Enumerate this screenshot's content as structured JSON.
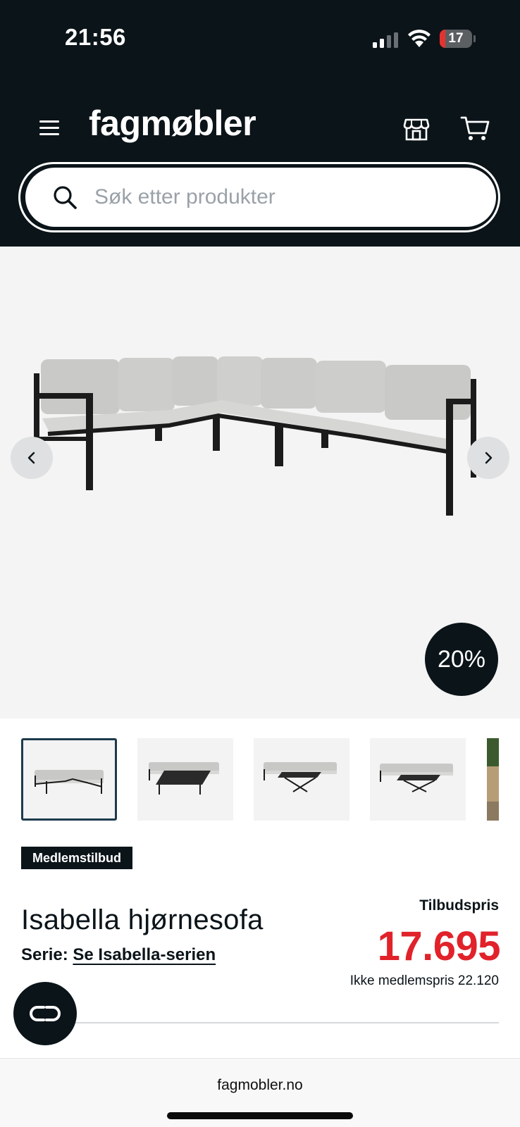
{
  "status_bar": {
    "time": "21:56",
    "battery_level": "17",
    "icons": [
      "signal-icon",
      "wifi-icon",
      "battery-icon"
    ]
  },
  "header": {
    "logo": "fagmøbler",
    "icons": [
      "menu-icon",
      "store-icon",
      "cart-icon"
    ]
  },
  "search": {
    "placeholder": "Søk etter produkter",
    "value": ""
  },
  "gallery": {
    "discount_badge": "20%",
    "thumbnail_count_visible": 5,
    "active_thumbnail": 1
  },
  "product": {
    "badge": "Medlemstilbud",
    "title": "Isabella hjørnesofa",
    "series_label": "Serie:",
    "series_link": "Se Isabella-serien",
    "price_label": "Tilbudspris",
    "price": "17.695",
    "member_price": "Ikke medlemspris 22.120"
  },
  "browser": {
    "url": "fagmobler.no"
  },
  "colors": {
    "header_bg": "#0b1419",
    "price_red": "#e1222a",
    "gallery_bg": "#f4f4f4"
  }
}
